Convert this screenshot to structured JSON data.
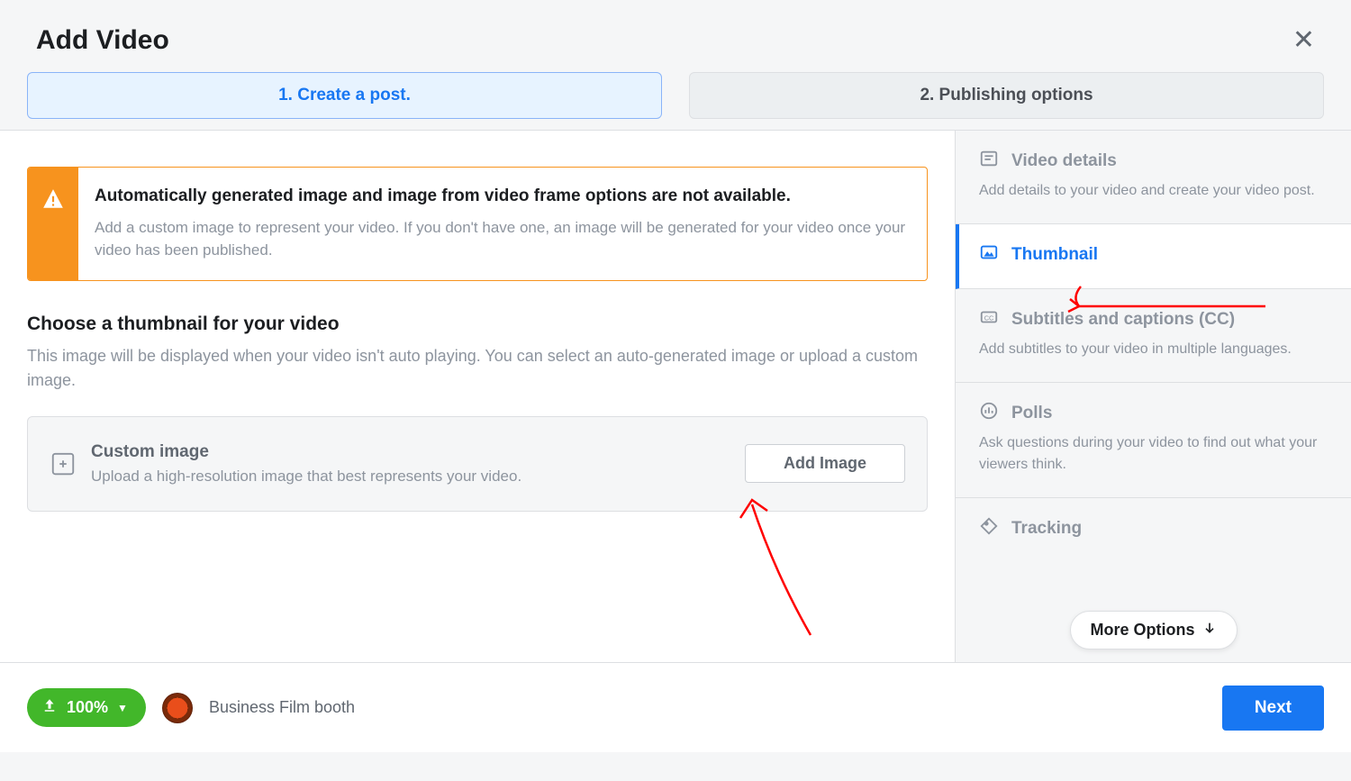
{
  "header": {
    "title": "Add Video"
  },
  "tabs": {
    "create": "1. Create a post.",
    "publish": "2. Publishing options"
  },
  "warning": {
    "title": "Automatically generated image and image from video frame options are not available.",
    "desc": "Add a custom image to represent your video. If you don't have one, an image will be generated for your video once your video has been published."
  },
  "thumbnail_section": {
    "title": "Choose a thumbnail for your video",
    "desc": "This image will be displayed when your video isn't auto playing. You can select an auto-generated image or upload a custom image."
  },
  "custom_image": {
    "title": "Custom image",
    "desc": "Upload a high-resolution image that best represents your video.",
    "button": "Add Image"
  },
  "sidebar": {
    "video_details": {
      "label": "Video details",
      "desc": "Add details to your video and create your video post."
    },
    "thumbnail": {
      "label": "Thumbnail"
    },
    "subtitles": {
      "label": "Subtitles and captions (CC)",
      "desc": "Add subtitles to your video in multiple languages."
    },
    "polls": {
      "label": "Polls",
      "desc": "Ask questions during your video to find out what your viewers think."
    },
    "tracking": {
      "label": "Tracking"
    },
    "more": "More Options"
  },
  "footer": {
    "upload_percent": "100%",
    "account": "Business Film booth",
    "next": "Next"
  },
  "colors": {
    "accent": "#1877f2",
    "warn": "#f7931e",
    "green": "#42b72a"
  }
}
